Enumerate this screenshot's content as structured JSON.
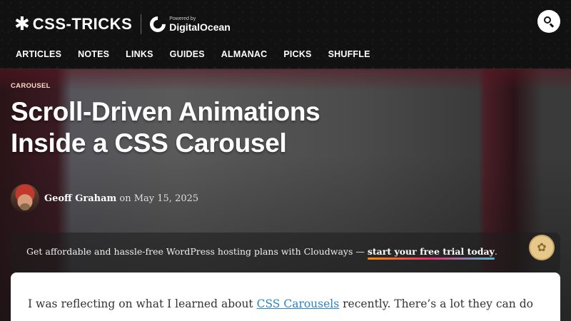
{
  "header": {
    "logo_star": "✱",
    "logo_text": "CSS-TRICKS",
    "sponsor_powered": "Powered by",
    "sponsor_name": "DigitalOcean",
    "search_icon": "search-icon"
  },
  "nav": {
    "items": [
      "ARTICLES",
      "NOTES",
      "LINKS",
      "GUIDES",
      "ALMANAC",
      "PICKS",
      "SHUFFLE"
    ]
  },
  "article": {
    "category": "CAROUSEL",
    "title_line1": "Scroll-Driven Animations",
    "title_line2": "Inside a CSS Carousel",
    "author": "Geoff Graham",
    "date_prefix": " on ",
    "date": "May 15, 2025",
    "intro_before": "I was reflecting on what I learned about ",
    "intro_link": "CSS Carousels",
    "intro_after": " recently. There’s a lot they can do"
  },
  "promo": {
    "text": "Get affordable and hassle-free WordPress hosting plans with Cloudways — ",
    "link": "start your free trial today",
    "suffix": "."
  },
  "colors": {
    "accent_link": "#2a82c8",
    "category": "#ffd8c8"
  }
}
